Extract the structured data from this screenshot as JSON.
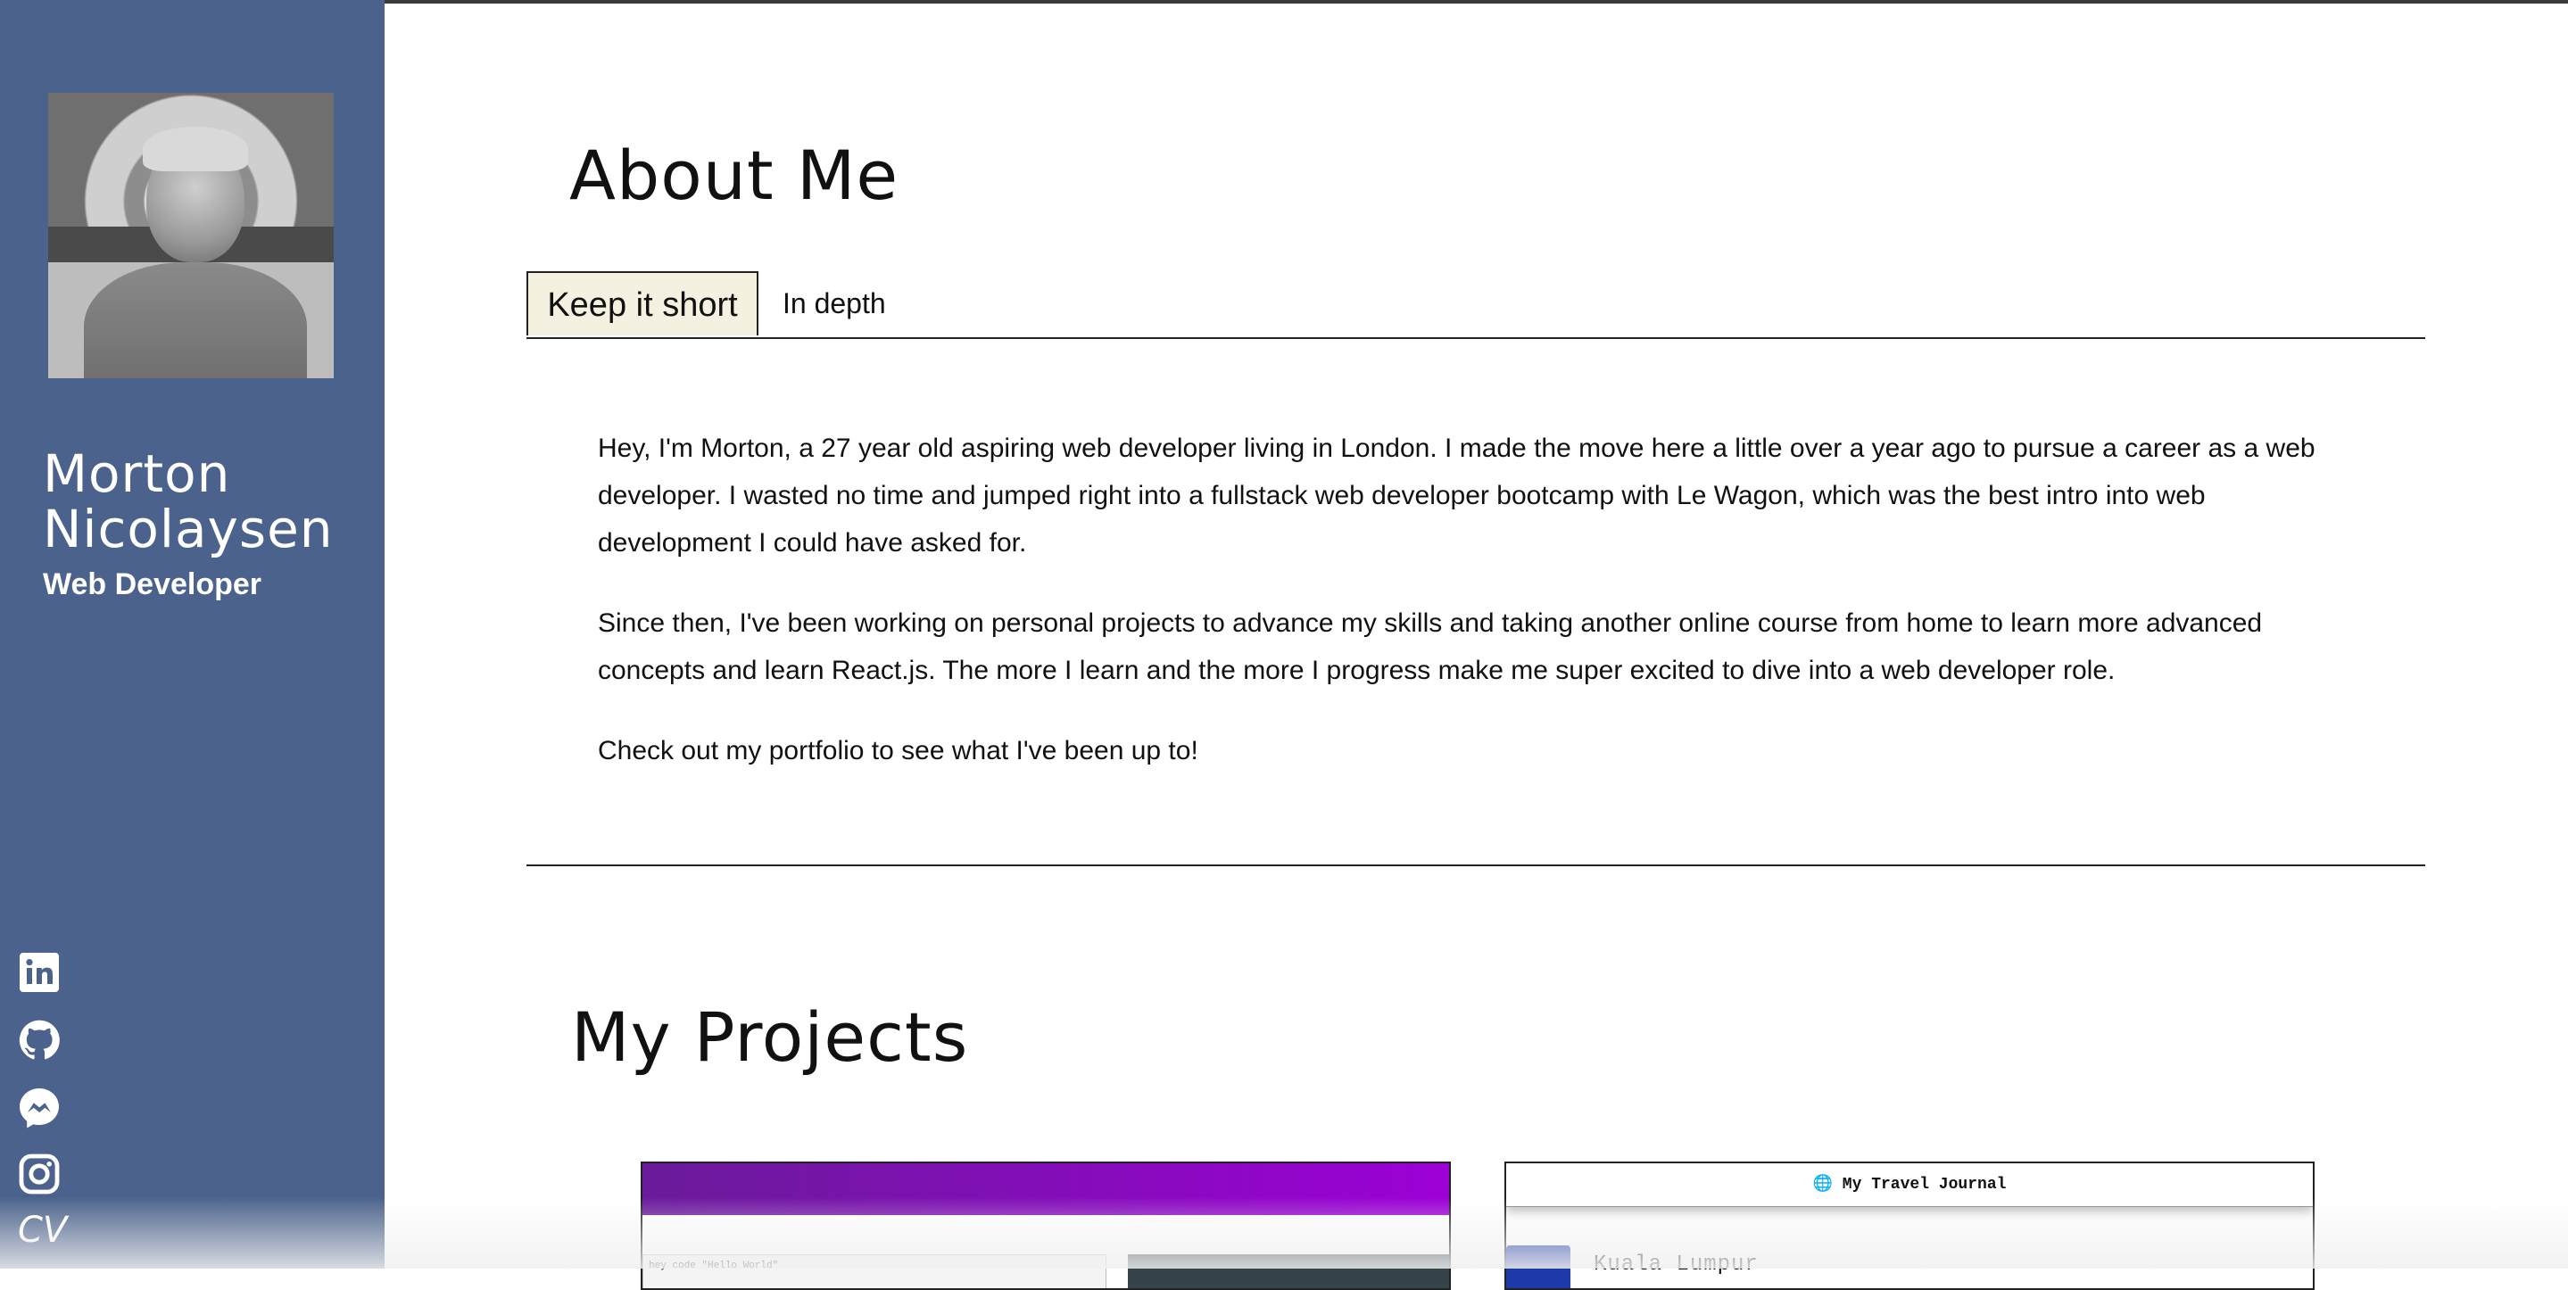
{
  "sidebar": {
    "name_line1": "Morton",
    "name_line2": "Nicolaysen",
    "role": "Web Developer",
    "social_icons": [
      "linkedin-icon",
      "github-icon",
      "messenger-icon",
      "instagram-icon"
    ],
    "cv_label": "CV",
    "background": "#4b638c"
  },
  "about": {
    "title": "About Me",
    "tabs": [
      {
        "label": "Keep it short",
        "active": true
      },
      {
        "label": "In depth",
        "active": false
      }
    ],
    "paragraphs": [
      "Hey,  I'm Morton,  a 27 year old aspiring web developer living in London.  I made the move here a little over a year ago to pursue a career as a web developer.  I wasted no time and jumped right into a fullstack web developer bootcamp with Le Wagon,  which was the best intro into web development I could have asked for.",
      "Since then,  I've been working on personal projects to advance my skills and taking another online course from home to learn more advanced concepts and learn React.js.  The more I learn and the more I progress make me super excited to dive into a web developer role.",
      "Check out my portfolio to see what I've been up to!"
    ]
  },
  "projects": {
    "title": "My Projects",
    "card1": {
      "field_text": "hey code \"Hello World\""
    },
    "card2": {
      "header": "🌐 My Travel Journal",
      "place": "Kuala Lumpur"
    }
  }
}
